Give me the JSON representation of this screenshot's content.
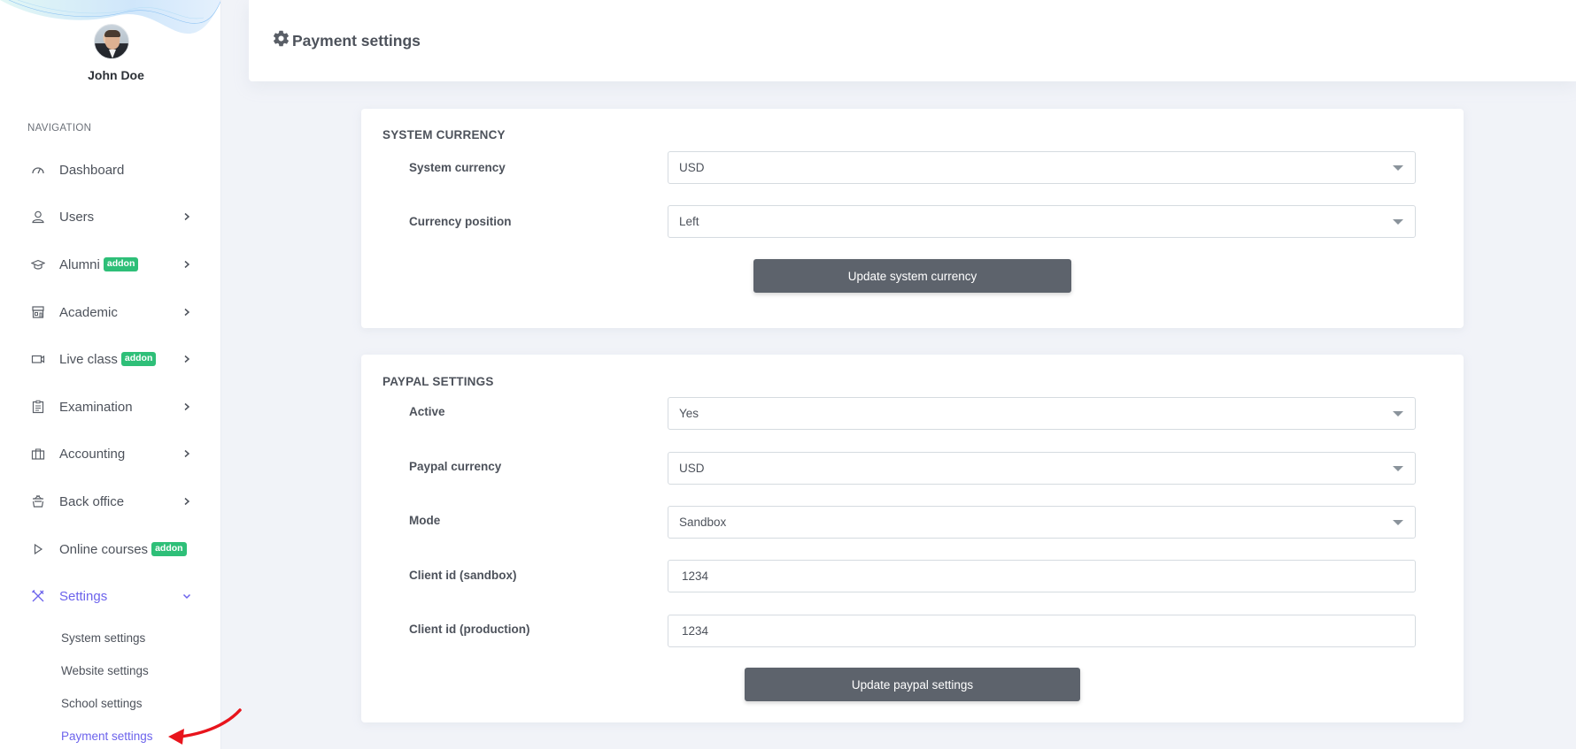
{
  "user": {
    "name": "John Doe"
  },
  "sidebar": {
    "heading": "NAVIGATION",
    "items": [
      {
        "label": "Dashboard",
        "icon": "dashboard-gauge-icon",
        "has_chevron": false
      },
      {
        "label": "Users",
        "icon": "user-icon",
        "has_chevron": true
      },
      {
        "label": "Alumni",
        "icon": "graduation-cap-icon",
        "badge": "addon",
        "has_chevron": true
      },
      {
        "label": "Academic",
        "icon": "store-icon",
        "has_chevron": true
      },
      {
        "label": "Live class",
        "icon": "video-camera-icon",
        "badge": "addon",
        "has_chevron": true
      },
      {
        "label": "Examination",
        "icon": "clipboard-icon",
        "has_chevron": true
      },
      {
        "label": "Accounting",
        "icon": "briefcase-icon",
        "has_chevron": true
      },
      {
        "label": "Back office",
        "icon": "basket-icon",
        "has_chevron": true
      },
      {
        "label": "Online courses",
        "icon": "play-icon",
        "badge": "addon",
        "has_chevron": false
      },
      {
        "label": "Settings",
        "icon": "tools-icon",
        "has_chevron": true,
        "expanded": true,
        "active": true
      }
    ],
    "settings_submenu": [
      {
        "label": "System settings"
      },
      {
        "label": "Website settings"
      },
      {
        "label": "School settings"
      },
      {
        "label": "Payment settings",
        "active": true
      }
    ]
  },
  "header": {
    "title": "Payment settings",
    "icon": "gear-icon"
  },
  "system_currency": {
    "title": "SYSTEM CURRENCY",
    "fields": [
      {
        "label": "System currency",
        "type": "select",
        "value": "USD"
      },
      {
        "label": "Currency position",
        "type": "select",
        "value": "Left"
      }
    ],
    "button": "Update system currency"
  },
  "paypal": {
    "title": "PAYPAL SETTINGS",
    "fields": [
      {
        "label": "Active",
        "type": "select",
        "value": "Yes"
      },
      {
        "label": "Paypal currency",
        "type": "select",
        "value": "USD"
      },
      {
        "label": "Mode",
        "type": "select",
        "value": "Sandbox"
      },
      {
        "label": "Client id (sandbox)",
        "type": "input",
        "value": "1234"
      },
      {
        "label": "Client id (production)",
        "type": "input",
        "value": "1234"
      }
    ],
    "button": "Update paypal settings"
  },
  "colors": {
    "accent": "#6c63ec",
    "badge": "#2ebf78",
    "button": "#5d636c",
    "annotation_arrow": "#e8141c"
  }
}
